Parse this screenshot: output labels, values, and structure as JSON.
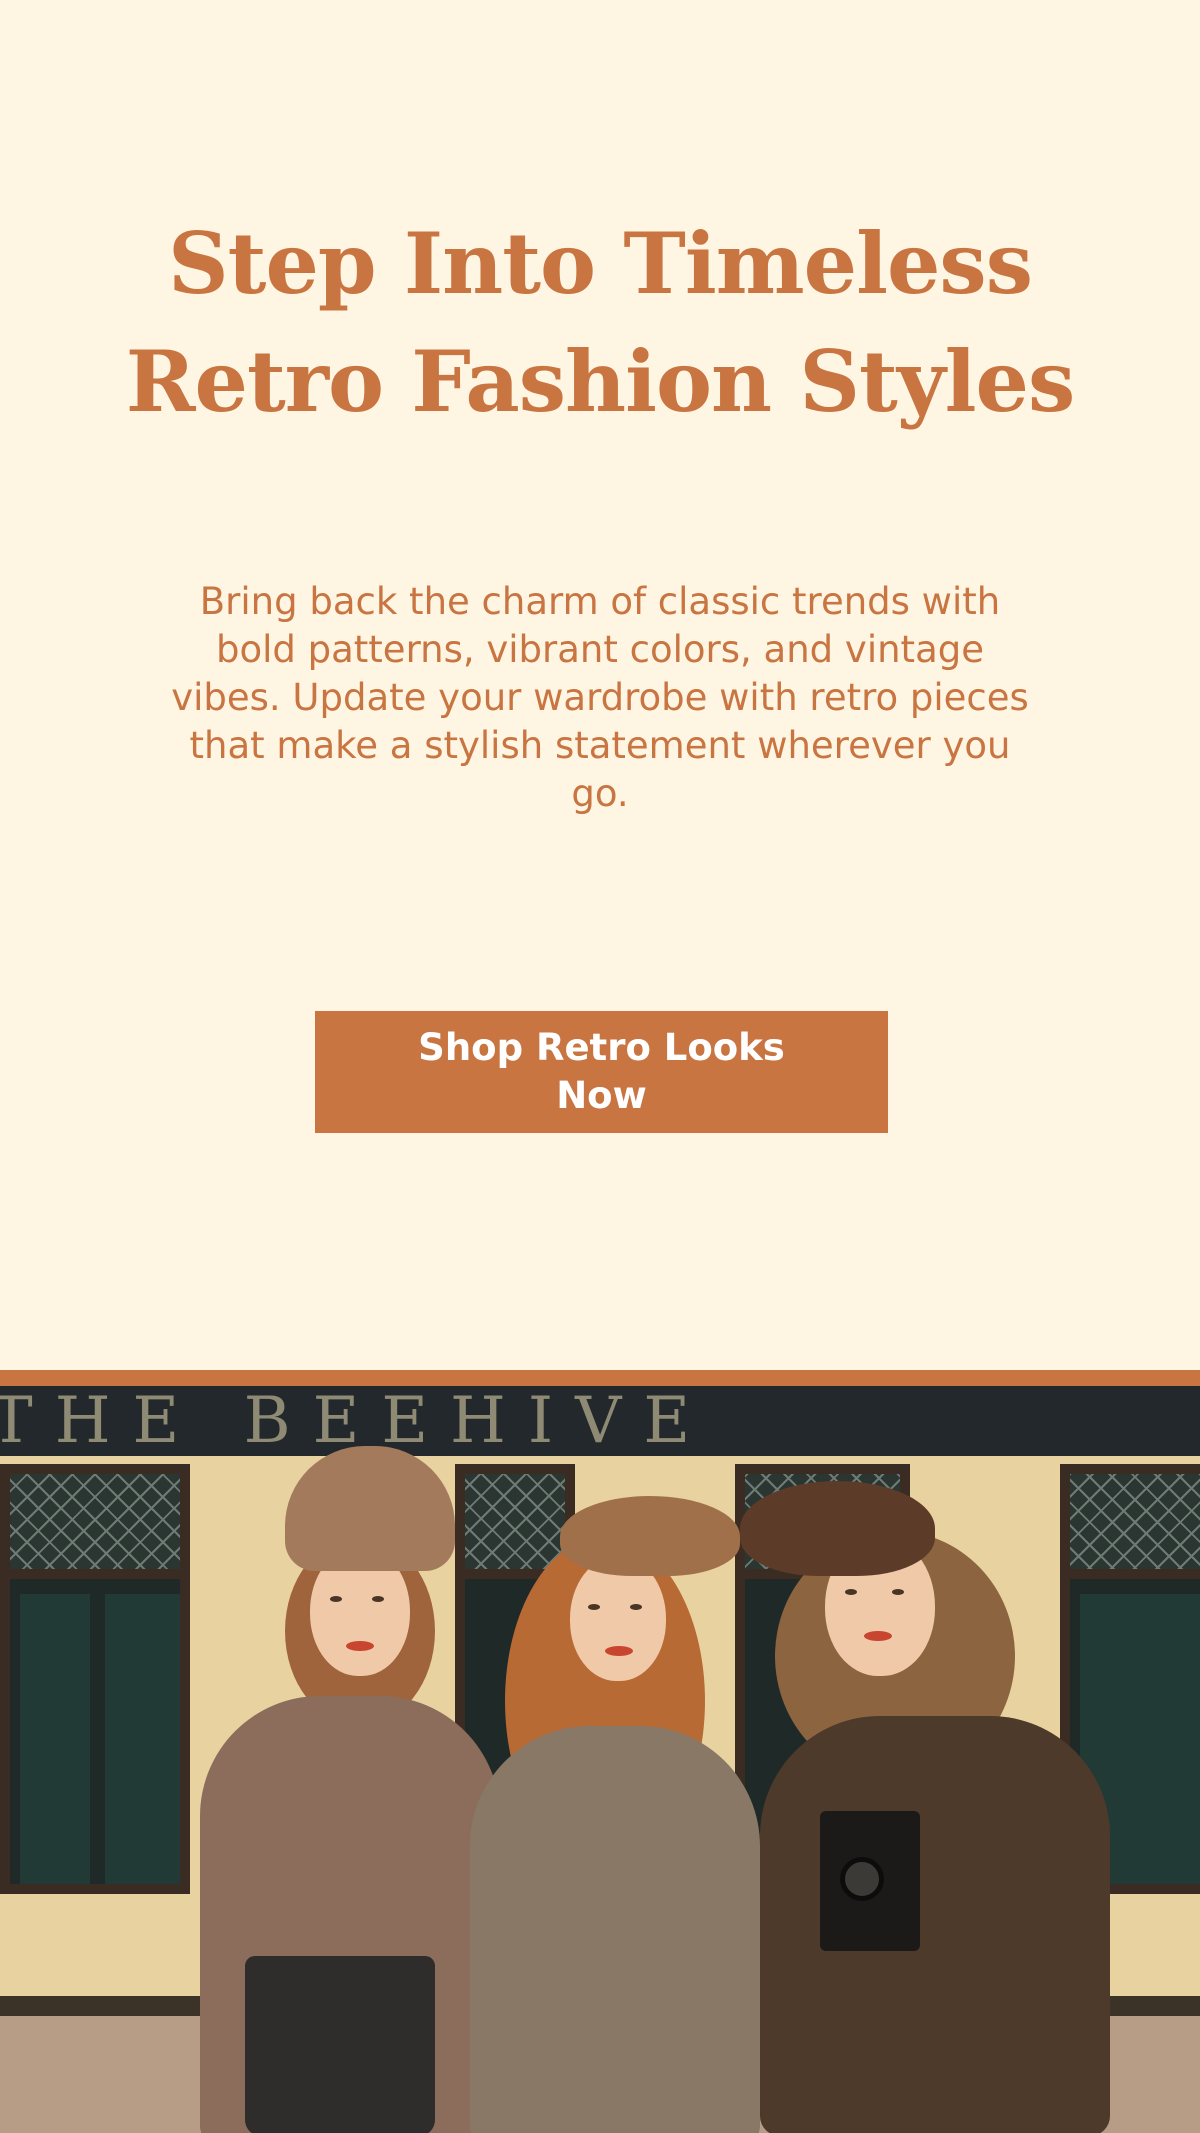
{
  "hero": {
    "headline_line1": "Step Into Timeless",
    "headline_line2": "Retro Fashion Styles",
    "subtext": "Bring back the charm of classic trends with bold patterns, vibrant colors, and vintage vibes. Update your wardrobe with retro pieces that make a stylish statement wherever you go.",
    "cta_label": "Shop Retro Looks Now"
  },
  "photo": {
    "storefront_sign": "THE BEEHIVE"
  },
  "colors": {
    "background": "#fff5e3",
    "accent": "#c97542",
    "button_text": "#ffffff"
  }
}
